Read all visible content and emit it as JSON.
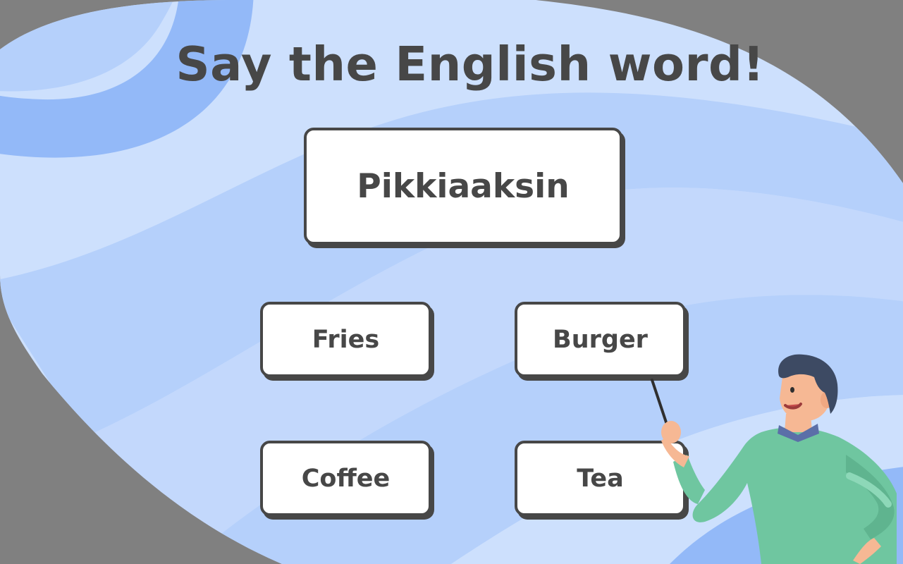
{
  "game": {
    "instruction": "Say the English word!",
    "prompt_word": "Pikkiaaksin",
    "options": [
      "Fries",
      "Burger",
      "Coffee",
      "Tea"
    ]
  },
  "colors": {
    "background_gray": "#808080",
    "blob_light": "#cde0fd",
    "blob_mid": "#b5d0fb",
    "blob_dark": "#93b9f8",
    "text_dark": "#474747",
    "card_white": "#ffffff",
    "shirt_green": "#6fc6a0",
    "hair_dark": "#3d4a63",
    "skin": "#f6b894"
  },
  "icons": {
    "character": "teacher-with-pointer-illustration"
  }
}
